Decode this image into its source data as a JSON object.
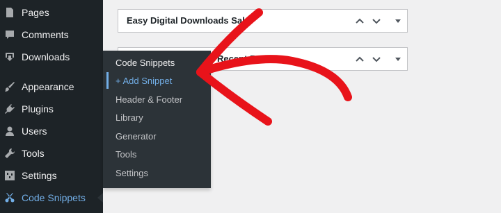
{
  "sidebar": {
    "items": [
      {
        "label": "Pages",
        "icon": "pages-icon"
      },
      {
        "label": "Comments",
        "icon": "comments-icon"
      },
      {
        "label": "Downloads",
        "icon": "download-icon"
      },
      {
        "label": "Appearance",
        "icon": "paintbrush-icon"
      },
      {
        "label": "Plugins",
        "icon": "plugin-icon"
      },
      {
        "label": "Users",
        "icon": "user-icon"
      },
      {
        "label": "Tools",
        "icon": "wrench-icon"
      },
      {
        "label": "Settings",
        "icon": "settings-icon"
      },
      {
        "label": "Code Snippets",
        "icon": "code-snippets-icon",
        "active": true
      }
    ]
  },
  "flyout": {
    "title": "Code Snippets",
    "items": [
      "+ Add Snippet",
      "Header & Footer",
      "Library",
      "Generator",
      "Tools",
      "Settings"
    ],
    "current": "+ Add Snippet"
  },
  "dashboard": {
    "boxes": [
      {
        "title": "Easy Digital Downloads Sales Summary",
        "visible_title": "Easy Digital Downloads Sal"
      },
      {
        "title": "Recent Reviews",
        "visible_title": "Recent Revie"
      }
    ]
  },
  "colors": {
    "sidebar_bg": "#1d2327",
    "flyout_bg": "#2c3338",
    "accent": "#72aee6",
    "annotation": "#e8131a"
  }
}
